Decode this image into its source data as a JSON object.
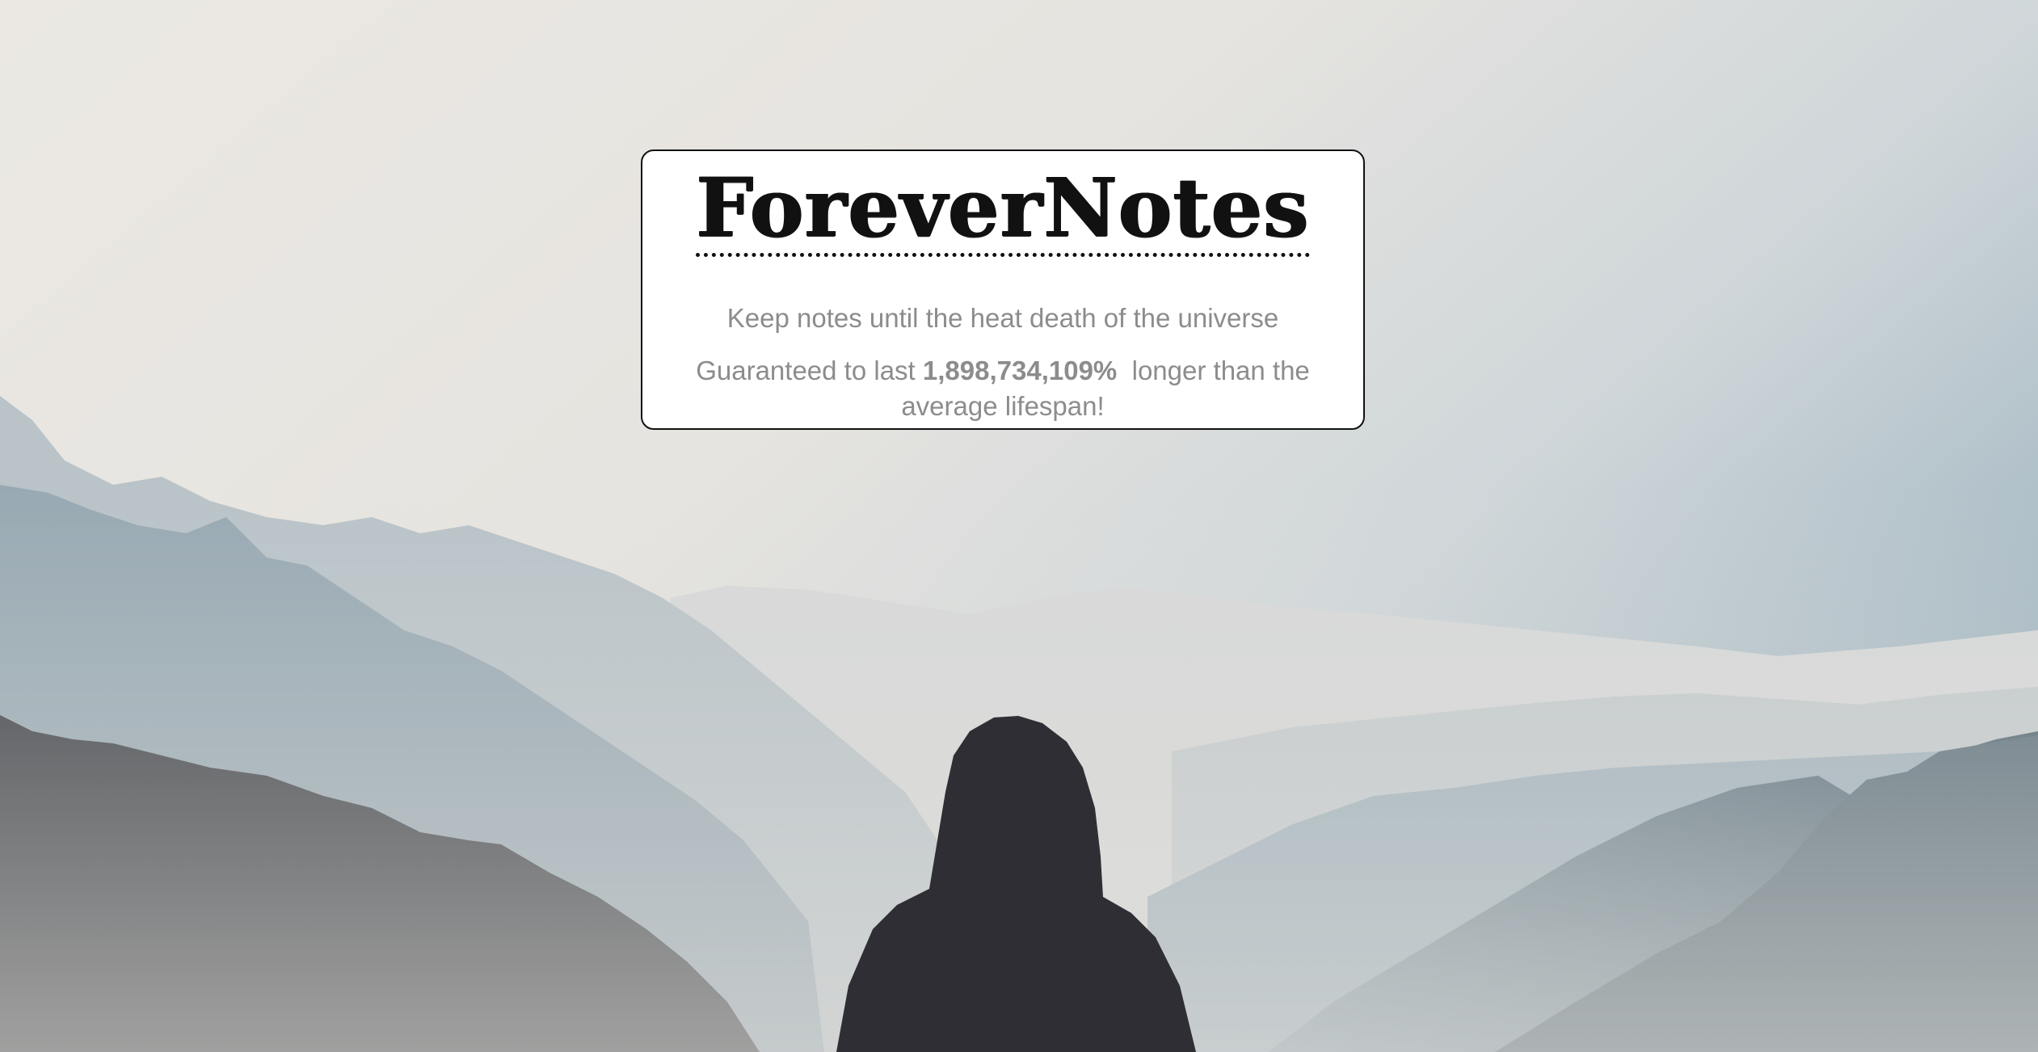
{
  "brand": {
    "logo_text": "ForeverNotes"
  },
  "hero": {
    "tagline": "Keep notes until the heat death of the universe",
    "guarantee_prefix": "Guaranteed to last ",
    "guarantee_value": "1,898,734,109%",
    "guarantee_suffix": "  longer than the average lifespan!"
  },
  "background": {
    "image_semantic": "misty-mountains-hooded-person",
    "colors": {
      "sky_light": "#ece8e2",
      "sky_blue": "#a9bcc6",
      "mountain_far": "#c9cfd3",
      "mountain_mid": "#9fb0ba",
      "mountain_near": "#6f828d",
      "cliff_dark": "#3a3d43",
      "figure": "#2e2d33"
    }
  },
  "colors": {
    "card_bg": "#ffffff",
    "card_border": "#111111",
    "text_muted": "#8c8c8c",
    "logo": "#111111"
  }
}
